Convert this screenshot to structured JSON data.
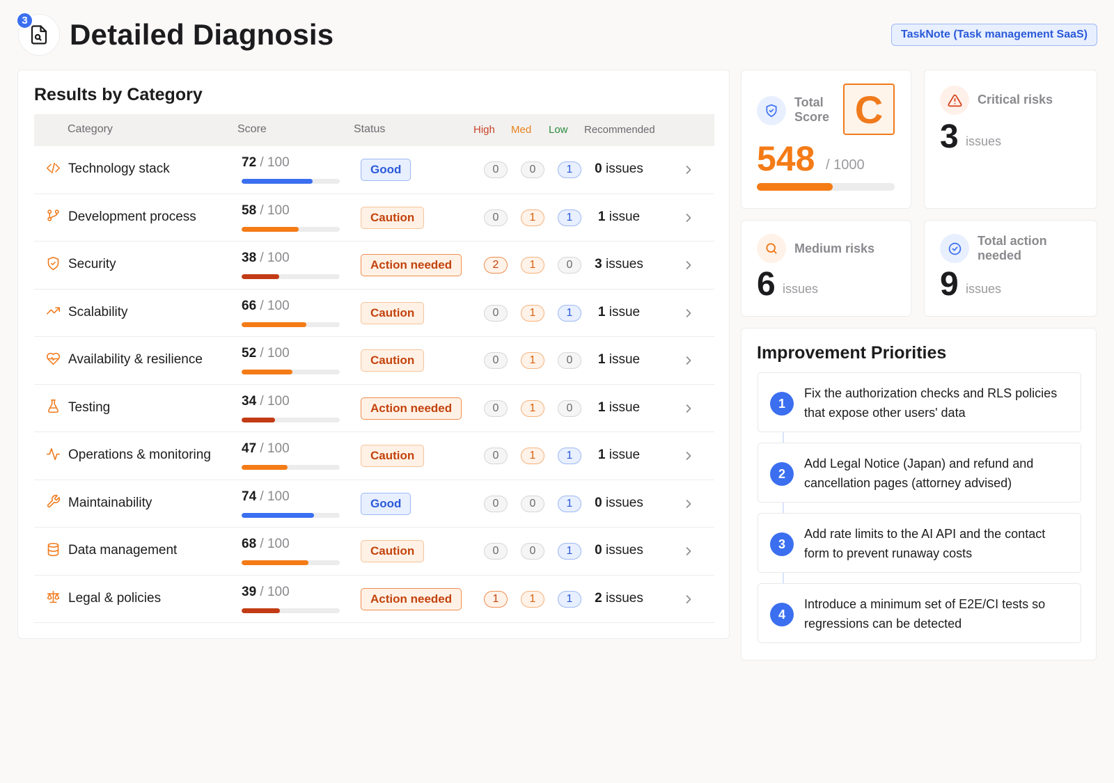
{
  "header": {
    "step_number": "3",
    "page_icon": "file-search-icon",
    "title": "Detailed Diagnosis",
    "project": "TaskNote (Task management SaaS)"
  },
  "results": {
    "title": "Results by Category",
    "columns": {
      "category": "Category",
      "score": "Score",
      "status": "Status",
      "high": "High",
      "med": "Med",
      "low": "Low",
      "recommended": "Recommended"
    },
    "score_suffix": "/ 100",
    "rows": [
      {
        "icon": "code-icon",
        "name": "Technology stack",
        "score": 72,
        "status": "Good",
        "status_type": "good",
        "high": "0",
        "med": "0",
        "low": "1",
        "rec_count": "0",
        "rec_unit": "issues"
      },
      {
        "icon": "git-branch-icon",
        "name": "Development process",
        "score": 58,
        "status": "Caution",
        "status_type": "caution",
        "high": "0",
        "med": "1",
        "low": "1",
        "rec_count": "1",
        "rec_unit": "issue"
      },
      {
        "icon": "shield-check-icon",
        "name": "Security",
        "score": 38,
        "status": "Action needed",
        "status_type": "action",
        "high": "2",
        "med": "1",
        "low": "0",
        "rec_count": "3",
        "rec_unit": "issues"
      },
      {
        "icon": "trending-up-icon",
        "name": "Scalability",
        "score": 66,
        "status": "Caution",
        "status_type": "caution",
        "high": "0",
        "med": "1",
        "low": "1",
        "rec_count": "1",
        "rec_unit": "issue"
      },
      {
        "icon": "heart-pulse-icon",
        "name": "Availability & resilience",
        "score": 52,
        "status": "Caution",
        "status_type": "caution",
        "high": "0",
        "med": "1",
        "low": "0",
        "rec_count": "1",
        "rec_unit": "issue"
      },
      {
        "icon": "flask-icon",
        "name": "Testing",
        "score": 34,
        "status": "Action needed",
        "status_type": "action",
        "high": "0",
        "med": "1",
        "low": "0",
        "rec_count": "1",
        "rec_unit": "issue"
      },
      {
        "icon": "activity-icon",
        "name": "Operations & monitoring",
        "score": 47,
        "status": "Caution",
        "status_type": "caution",
        "high": "0",
        "med": "1",
        "low": "1",
        "rec_count": "1",
        "rec_unit": "issue"
      },
      {
        "icon": "wrench-icon",
        "name": "Maintainability",
        "score": 74,
        "status": "Good",
        "status_type": "good",
        "high": "0",
        "med": "0",
        "low": "1",
        "rec_count": "0",
        "rec_unit": "issues"
      },
      {
        "icon": "database-icon",
        "name": "Data management",
        "score": 68,
        "status": "Caution",
        "status_type": "caution",
        "high": "0",
        "med": "0",
        "low": "1",
        "rec_count": "0",
        "rec_unit": "issues"
      },
      {
        "icon": "scale-icon",
        "name": "Legal & policies",
        "score": 39,
        "status": "Action needed",
        "status_type": "action",
        "high": "1",
        "med": "1",
        "low": "1",
        "rec_count": "2",
        "rec_unit": "issues"
      }
    ]
  },
  "total_score": {
    "label": "Total Score",
    "icon": "shield-check-icon",
    "value": "548",
    "max": "/ 1000",
    "progress": 0.548,
    "grade": "C"
  },
  "critical": {
    "label": "Critical risks",
    "icon": "alert-triangle-icon",
    "value": "3",
    "unit": "issues"
  },
  "medium": {
    "label": "Medium risks",
    "icon": "search-icon",
    "value": "6",
    "unit": "issues"
  },
  "actions": {
    "label": "Total action needed",
    "icon": "check-circle-icon",
    "value": "9",
    "unit": "issues"
  },
  "priorities": {
    "title": "Improvement Priorities",
    "items": [
      {
        "n": "1",
        "text": "Fix the authorization checks and RLS policies that expose other users' data"
      },
      {
        "n": "2",
        "text": "Add Legal Notice (Japan) and refund and cancellation pages (attorney advised)"
      },
      {
        "n": "3",
        "text": "Add rate limits to the AI API and the contact form to prevent runaway costs"
      },
      {
        "n": "4",
        "text": "Introduce a minimum set of E2E/CI tests so regressions can be detected"
      }
    ]
  },
  "colors": {
    "accent_blue": "#3b6ff0",
    "good_bar": "#3b6ff0",
    "caution_bar": "#f47b16",
    "action_bar": "#c23b14",
    "brand_orange": "#f07a1c"
  }
}
